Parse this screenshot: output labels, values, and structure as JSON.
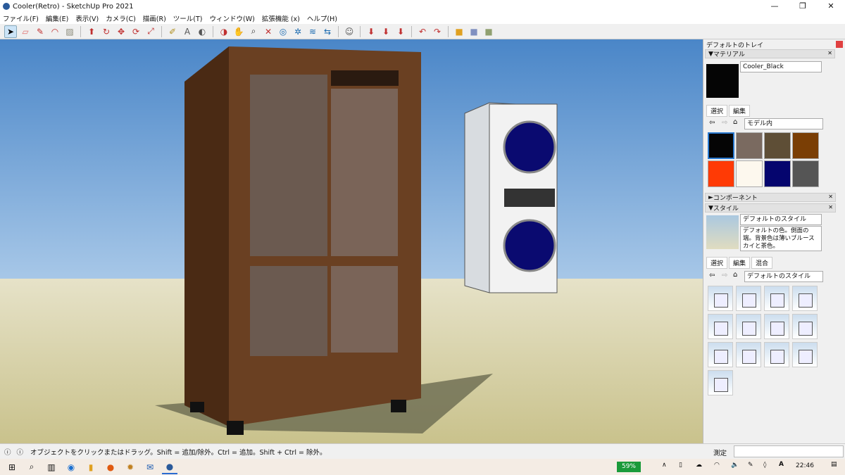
{
  "window": {
    "title": "Cooler(Retro) - SketchUp Pro 2021",
    "minimize": "—",
    "maximize": "❐",
    "close": "✕"
  },
  "menu": [
    "ファイル(F)",
    "編集(E)",
    "表示(V)",
    "カメラ(C)",
    "描画(R)",
    "ツール(T)",
    "ウィンドウ(W)",
    "拡張機能 (x)",
    "ヘルプ(H)"
  ],
  "toolbar": [
    "select-icon",
    "eraser-icon",
    "pencil-icon",
    "arc-icon",
    "shape-icon",
    "push-pull-icon",
    "follow-me-icon",
    "move-icon",
    "rotate-icon",
    "scale-icon",
    "tape-measure-icon",
    "text-icon",
    "paint-bucket-icon",
    "orbit-icon",
    "pan-icon",
    "zoom-icon",
    "zoom-extents-icon",
    "warehouse-icon",
    "extension-icon",
    "layers-icon",
    "share-icon",
    "profile-icon",
    "sandbox-j-icon",
    "sandbox-v-icon",
    "sandbox-n-icon",
    "tool-a-icon",
    "tool-b-icon",
    "box-yellow-icon",
    "box-blue-icon",
    "box-green-icon"
  ],
  "tray": {
    "title": "デフォルトのトレイ",
    "materials": {
      "header": "マテリアル",
      "name": "Cooler_Black",
      "current_color": "#050505",
      "tabs": [
        "選択",
        "編集"
      ],
      "dropdown": "モデル内",
      "swatches": [
        "#050505",
        "#7a6a60",
        "#5e4e36",
        "#7a3e05",
        "#ff3a05",
        "#fdf8ee",
        "#05056e",
        "#555555"
      ]
    },
    "components": {
      "header": "コンポーネント"
    },
    "styles": {
      "header": "スタイル",
      "name": "デフォルトのスタイル",
      "description": "デフォルトの色。側面の端。背景色は薄いブルースカイと茶色。",
      "tabs": [
        "選択",
        "編集",
        "混合"
      ],
      "dropdown": "デフォルトのスタイル",
      "thumbnail_count": 13
    }
  },
  "status": {
    "message": "オブジェクトをクリックまたはドラッグ。Shift = 追加/除外。Ctrl = 追加。Shift + Ctrl = 除外。",
    "measure_label": "測定",
    "measure_value": ""
  },
  "taskbar": {
    "battery": "59%",
    "time": "22:46",
    "ime": "A"
  }
}
